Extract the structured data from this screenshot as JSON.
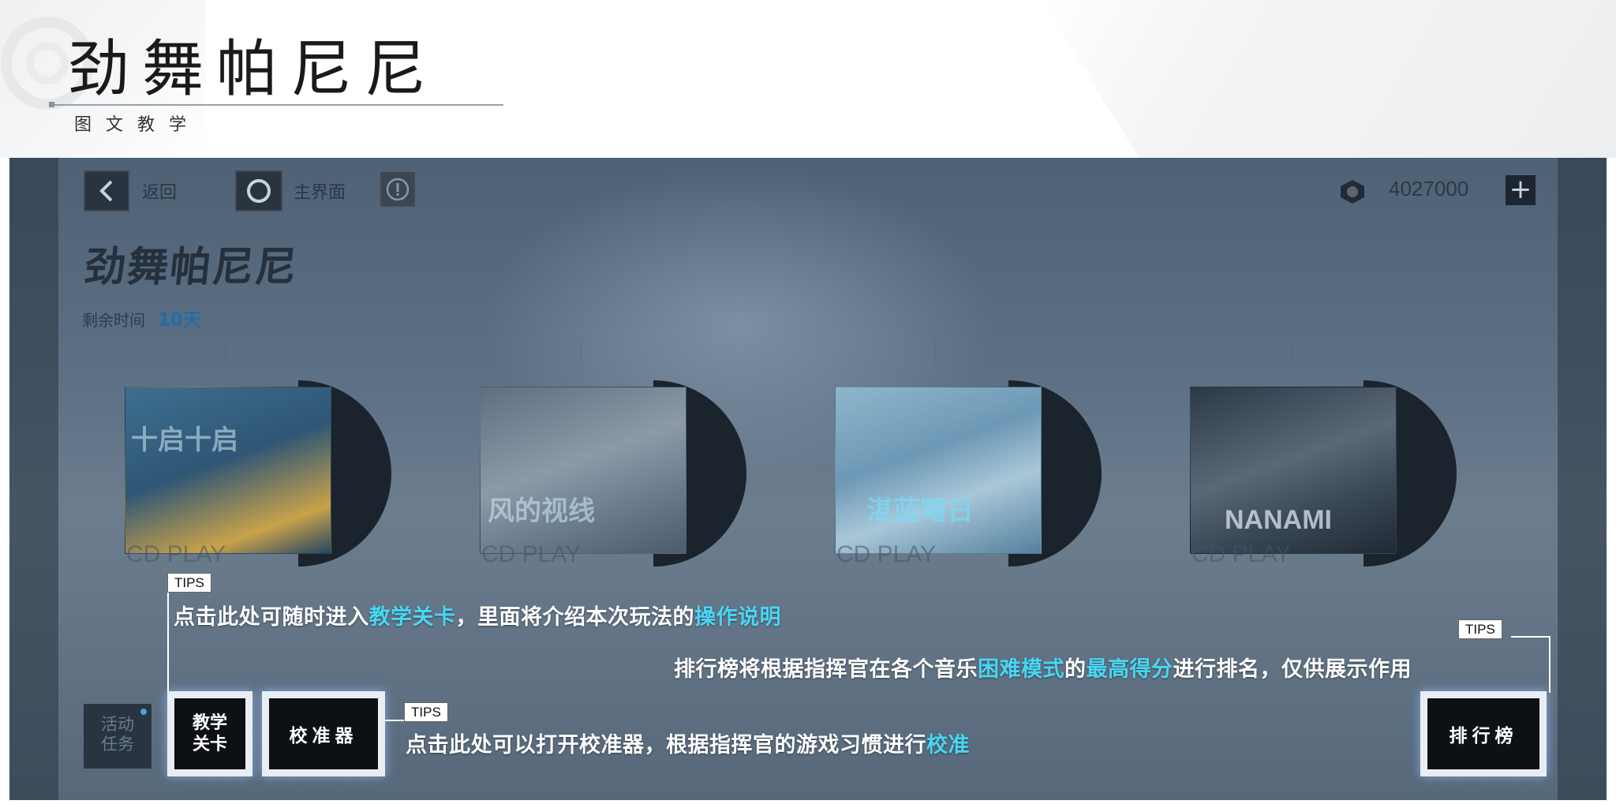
{
  "header": {
    "title": "劲舞帕尼尼",
    "subtitle": "图文教学"
  },
  "game": {
    "topbar": {
      "back_label": "返回",
      "home_label": "主界面",
      "currency_value": "4027000",
      "plus_symbol": "+"
    },
    "event": {
      "logo_text": "劲舞帕尼尼",
      "remaining_label": "剩余时间",
      "remaining_value": "10天"
    },
    "albums": [
      {
        "cover_text": "十启十启",
        "cd_label": "CD PLAY"
      },
      {
        "cover_text": "风的视线",
        "cd_label": "CD PLAY"
      },
      {
        "cover_text": "湛蓝曙日",
        "cd_label": "CD PLAY"
      },
      {
        "cover_text": "NANAMI",
        "cd_label": "CD PLAY"
      }
    ],
    "side_tasks_label": [
      "活动",
      "任务"
    ],
    "buttons": {
      "tutorial": [
        "教学",
        "关卡"
      ],
      "calibrator": "校准器",
      "leaderboard": "排行榜"
    }
  },
  "tips": {
    "badge": "TIPS",
    "tutorial": [
      "点击此处可随时进入",
      "教学关卡",
      "，里面将介绍本次玩法的",
      "操作说明"
    ],
    "leaderboard": [
      "排行榜将根据指挥官在各个音乐",
      "困难模式",
      "的",
      "最高得分",
      "进行排名，仅供展示作用"
    ],
    "calibrator": [
      "点击此处可以打开校准器，根据指挥官的游戏习惯进行",
      "校准"
    ]
  },
  "colors": {
    "highlight": "#49d6f3",
    "remaining": "#1f6ea8"
  }
}
